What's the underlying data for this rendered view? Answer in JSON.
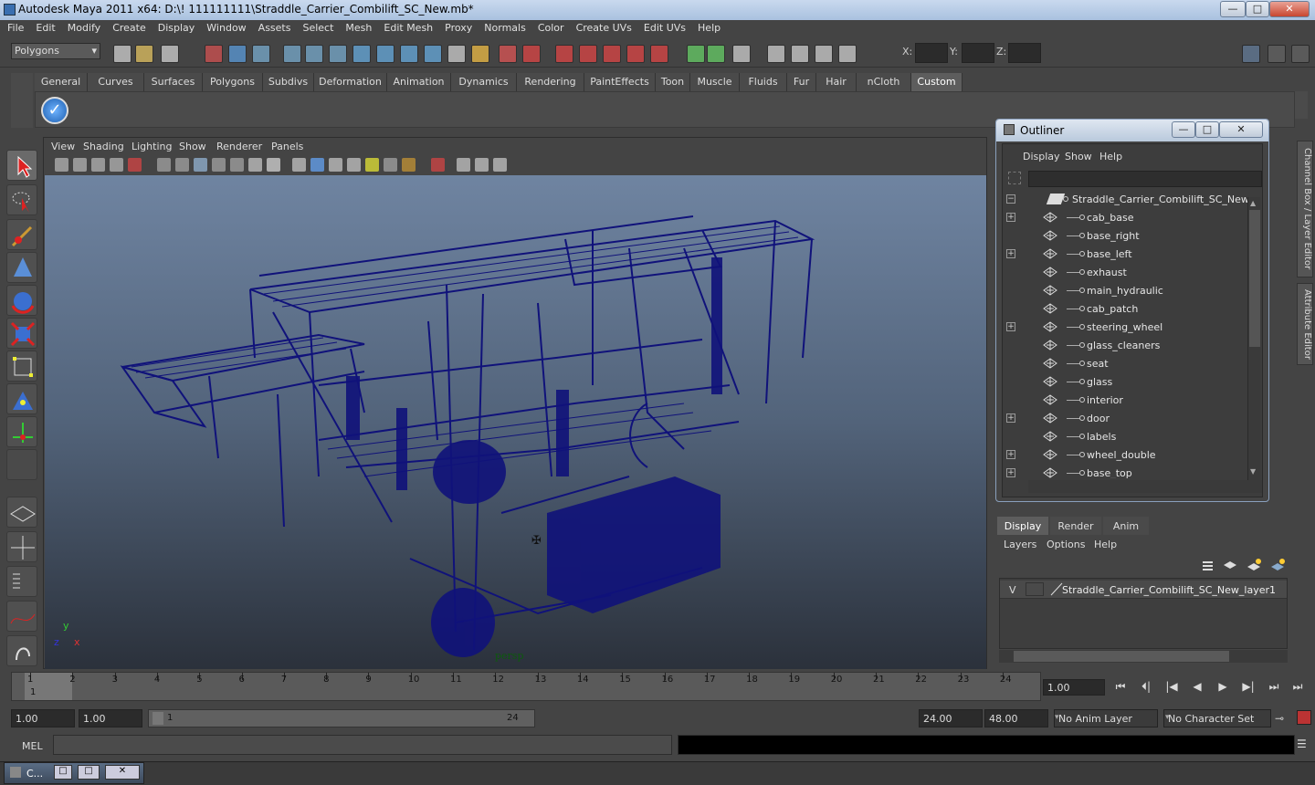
{
  "window": {
    "title": "Autodesk Maya 2011 x64: D:\\! 111111111\\Straddle_Carrier_Combilift_SC_New.mb*",
    "btn_min": "—",
    "btn_max": "□",
    "btn_close": "✕"
  },
  "menubar": [
    "File",
    "Edit",
    "Modify",
    "Create",
    "Display",
    "Window",
    "Assets",
    "Select",
    "Mesh",
    "Edit Mesh",
    "Proxy",
    "Normals",
    "Color",
    "Create UVs",
    "Edit UVs",
    "Help"
  ],
  "statusline": {
    "mode": "Polygons",
    "x_label": "X:",
    "y_label": "Y:",
    "z_label": "Z:"
  },
  "shelf_tabs": [
    "General",
    "Curves",
    "Surfaces",
    "Polygons",
    "Subdivs",
    "Deformation",
    "Animation",
    "Dynamics",
    "Rendering",
    "PaintEffects",
    "Toon",
    "Muscle",
    "Fluids",
    "Fur",
    "Hair",
    "nCloth",
    "Custom"
  ],
  "shelf_active": "Custom",
  "viewport": {
    "menus": [
      "View",
      "Shading",
      "Lighting",
      "Show",
      "Renderer",
      "Panels"
    ],
    "camera": "persp",
    "axis_x": "x",
    "axis_y": "y",
    "axis_z": "z"
  },
  "outliner": {
    "title": "Outliner",
    "menus": [
      "Display",
      "Show",
      "Help"
    ],
    "root": "Straddle_Carrier_Combilift_SC_New",
    "items": [
      {
        "label": "cab_base",
        "expand": "+"
      },
      {
        "label": "base_right",
        "expand": ""
      },
      {
        "label": "base_left",
        "expand": "+"
      },
      {
        "label": "exhaust",
        "expand": ""
      },
      {
        "label": "main_hydraulic",
        "expand": ""
      },
      {
        "label": "cab_patch",
        "expand": ""
      },
      {
        "label": "steering_wheel",
        "expand": "+"
      },
      {
        "label": "glass_cleaners",
        "expand": ""
      },
      {
        "label": "seat",
        "expand": ""
      },
      {
        "label": "glass",
        "expand": ""
      },
      {
        "label": "interior",
        "expand": ""
      },
      {
        "label": "door",
        "expand": "+"
      },
      {
        "label": "labels",
        "expand": ""
      },
      {
        "label": "wheel_double",
        "expand": "+"
      },
      {
        "label": "base_top",
        "expand": "+"
      }
    ],
    "collapse_symbol": "−"
  },
  "sidebar_tabs": [
    "Channel Box / Layer Editor",
    "Attribute Editor"
  ],
  "layer_editor": {
    "tabs": [
      "Display",
      "Render",
      "Anim"
    ],
    "menus": [
      "Layers",
      "Options",
      "Help"
    ],
    "layer_visible": "V",
    "layer_name": "Straddle_Carrier_Combilift_SC_New_layer1"
  },
  "timeline": {
    "ticks": [
      "1",
      "2",
      "3",
      "4",
      "5",
      "6",
      "7",
      "8",
      "9",
      "10",
      "11",
      "12",
      "13",
      "14",
      "15",
      "16",
      "17",
      "18",
      "19",
      "20",
      "21",
      "22",
      "23",
      "24"
    ],
    "current_marker": "1",
    "current_frame": "1.00"
  },
  "playback_buttons": [
    "⏮",
    "⏴|",
    "|◀",
    "◀",
    "▶",
    "▶|",
    "⏭",
    "⏭"
  ],
  "range": {
    "start": "1.00",
    "start2": "1.00",
    "slider_min": "1",
    "slider_max": "24",
    "end": "24.00",
    "end2": "48.00",
    "anim_layer": "No Anim Layer",
    "char_set": "No Character Set"
  },
  "cmdline": {
    "label": "MEL"
  },
  "taskbar": {
    "label": "C..."
  }
}
